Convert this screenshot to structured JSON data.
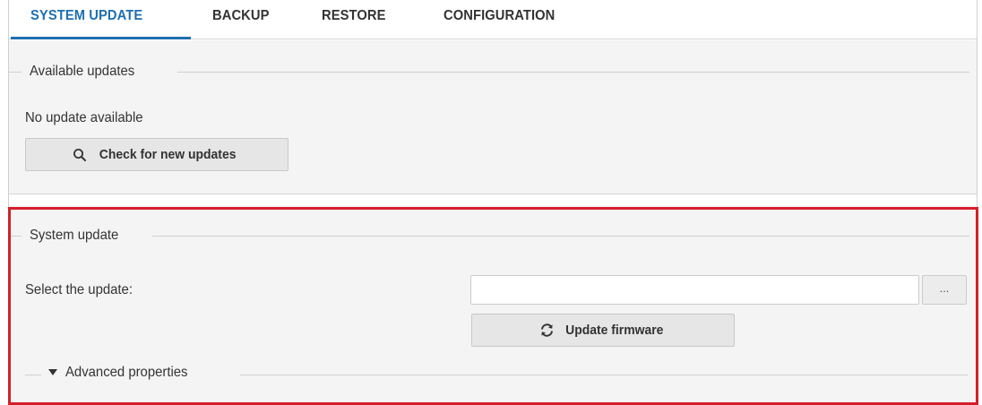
{
  "tabs": [
    {
      "label": "SYSTEM UPDATE",
      "active": true
    },
    {
      "label": "BACKUP",
      "active": false
    },
    {
      "label": "RESTORE",
      "active": false
    },
    {
      "label": "CONFIGURATION",
      "active": false
    }
  ],
  "available_updates": {
    "legend": "Available updates",
    "status": "No update available",
    "check_button": {
      "label": "Check for new updates",
      "icon": "search-icon"
    }
  },
  "system_update": {
    "legend": "System update",
    "select_label": "Select the update:",
    "file_input": {
      "value": "",
      "placeholder": ""
    },
    "browse_label": "...",
    "update_button": {
      "label": "Update firmware",
      "icon": "refresh-icon"
    },
    "advanced": {
      "label": "Advanced properties",
      "icon": "caret-down-icon",
      "expanded": false
    }
  },
  "colors": {
    "accent": "#1f6fb0",
    "highlight": "#d41f2a",
    "panel_bg": "#f4f4f4"
  }
}
